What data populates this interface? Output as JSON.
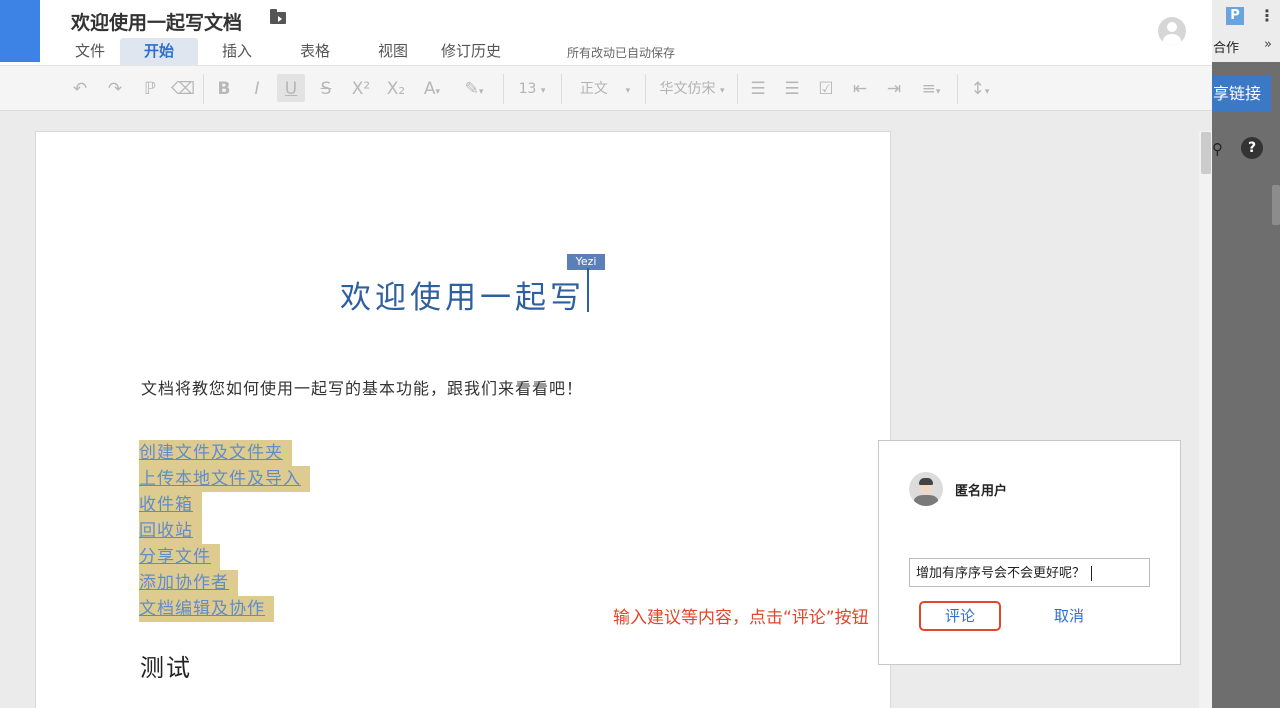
{
  "app": {
    "doc_title": "欢迎使用一起写文档",
    "autosave_status": "所有改动已自动保存"
  },
  "menu": {
    "items": [
      "文件",
      "开始",
      "插入",
      "表格",
      "视图",
      "修订历史"
    ],
    "active": "开始"
  },
  "toolbar": {
    "font_size": "13",
    "paragraph_style": "正文",
    "font_family": "华文仿宋",
    "icons": [
      "undo-icon",
      "redo-icon",
      "format-painter-icon",
      "clear-format-icon",
      "bold-icon",
      "italic-icon",
      "underline-icon",
      "strikethrough-icon",
      "superscript-icon",
      "subscript-icon",
      "text-color-icon",
      "highlight-icon",
      "ordered-list-icon",
      "bullet-list-icon",
      "checkbox-icon",
      "outdent-icon",
      "indent-icon",
      "align-icon",
      "line-spacing-icon"
    ]
  },
  "document": {
    "heading": "欢迎使用一起写",
    "cursor_user": "Yezi",
    "intro": "文档将教您如何使用一起写的基本功能，跟我们来看看吧！",
    "links": [
      "创建文件及文件夹",
      "上传本地文件及导入",
      "收件箱",
      "回收站",
      "分享文件",
      "添加协作者",
      "文档编辑及协作"
    ],
    "section_heading": "测试"
  },
  "comment": {
    "user_name": "匿名用户",
    "input_value": "增加有序序号会不会更好呢？",
    "submit_label": "评论",
    "cancel_label": "取消",
    "annotation": "输入建议等内容，点击“评论”按钮"
  },
  "right_panel": {
    "badge": "P",
    "collab_label": "合作",
    "more": "»",
    "share_label": "享链接"
  },
  "colors": {
    "accent": "#2f6fcd",
    "heading_blue": "#2e5f9e",
    "highlight": "#ddcb8f",
    "annotation_red": "#e2462b"
  }
}
